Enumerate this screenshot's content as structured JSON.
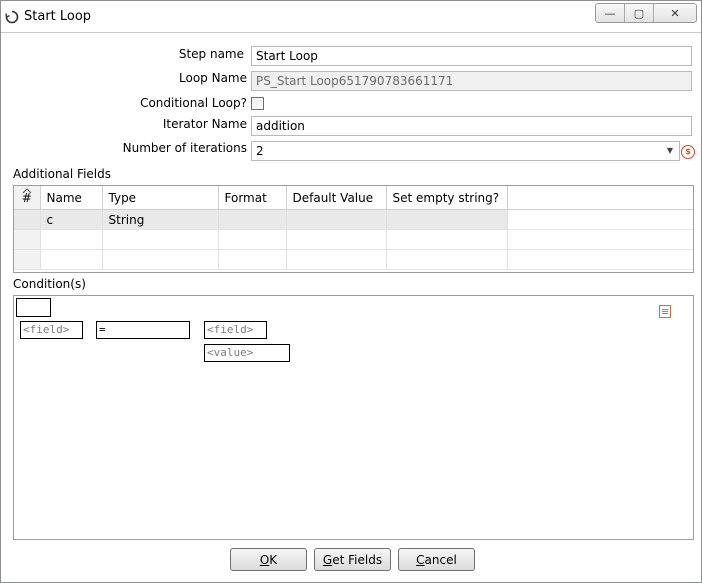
{
  "window": {
    "title": "Start Loop",
    "minimize_glyph": "—",
    "maximize_glyph": "▢",
    "close_glyph": "✕"
  },
  "form": {
    "step_name_label": "Step name",
    "step_name_value": "Start Loop",
    "loop_name_label": "Loop Name",
    "loop_name_value": "PS_Start Loop651790783661171",
    "conditional_label": "Conditional Loop?",
    "conditional_checked": false,
    "iterator_label": "Iterator Name",
    "iterator_value": "addition",
    "iterations_label": "Number of iterations",
    "iterations_value": "2",
    "variable_icon_glyph": "$"
  },
  "additional_fields": {
    "label": "Additional Fields",
    "rownum_header": "#",
    "columns": [
      "Name",
      "Type",
      "Format",
      "Default Value",
      "Set empty string?"
    ],
    "rows": [
      {
        "name": "c",
        "type": "String",
        "format": "",
        "default": "",
        "empty": ""
      }
    ]
  },
  "conditions": {
    "label": "Condition(s)",
    "left_field": "<field>",
    "operator": "=",
    "right_field": "<field>",
    "right_value": "<value>"
  },
  "buttons": {
    "ok_mnemonic": "O",
    "ok_rest": "K",
    "get_fields_mnemonic": "G",
    "get_fields_rest": "et Fields",
    "cancel_mnemonic": "C",
    "cancel_rest": "ancel"
  },
  "colors": {
    "accent_icon": "#d24a2a",
    "border": "#9d9d9d"
  }
}
